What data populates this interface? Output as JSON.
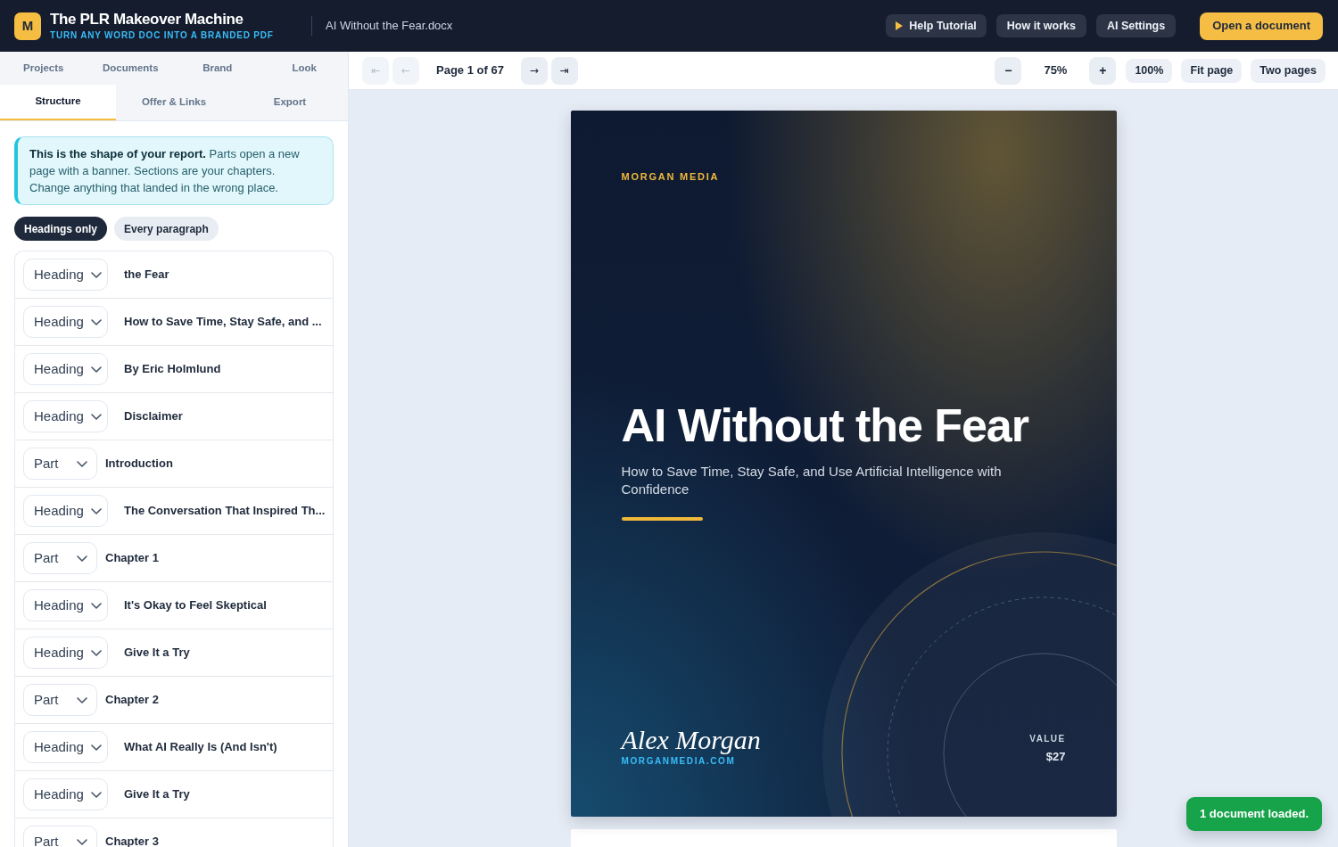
{
  "header": {
    "logo_letter": "M",
    "title": "The PLR Makeover Machine",
    "tagline": "TURN ANY WORD DOC INTO A BRANDED PDF",
    "file_name": "AI Without the Fear.docx",
    "buttons": [
      {
        "label": "Help Tutorial",
        "kind": "tutorial"
      },
      {
        "label": "How it works",
        "kind": "secondary"
      },
      {
        "label": "AI Settings",
        "kind": "secondary"
      },
      {
        "label": "Open a document",
        "kind": "primary"
      }
    ]
  },
  "sidebar": {
    "nav_tabs": [
      {
        "label": "Projects",
        "selected": false
      },
      {
        "label": "Documents",
        "selected": false
      },
      {
        "label": "Brand",
        "selected": false
      },
      {
        "label": "Look",
        "selected": false
      }
    ],
    "sub_tabs": [
      {
        "label": "Structure",
        "selected": true
      },
      {
        "label": "Offer & Links",
        "selected": false
      },
      {
        "label": "Export",
        "selected": false
      }
    ],
    "info": "**This is the shape of your report.** Parts open a new page with a banner. Sections are your chapters. Change anything that landed in the wrong place.",
    "view_modes": [
      {
        "label": "Headings only",
        "selected": true
      },
      {
        "label": "Every paragraph",
        "selected": false
      }
    ],
    "rows": [
      {
        "kind": "heading",
        "type": "Heading",
        "text": "the Fear"
      },
      {
        "kind": "heading",
        "type": "Heading",
        "text": "How to Save Time, Stay Safe, and ..."
      },
      {
        "kind": "heading",
        "type": "Heading",
        "text": "By Eric Holmlund"
      },
      {
        "kind": "heading",
        "type": "Heading",
        "text": "Disclaimer"
      },
      {
        "kind": "part",
        "type": "Part",
        "text": "Introduction"
      },
      {
        "kind": "heading",
        "type": "Heading",
        "text": "The Conversation That Inspired Th..."
      },
      {
        "kind": "part",
        "type": "Part",
        "text": "Chapter 1"
      },
      {
        "kind": "heading",
        "type": "Heading",
        "text": "It's Okay to Feel Skeptical"
      },
      {
        "kind": "heading",
        "type": "Heading",
        "text": "Give It a Try"
      },
      {
        "kind": "part",
        "type": "Part",
        "text": "Chapter 2"
      },
      {
        "kind": "heading",
        "type": "Heading",
        "text": "What AI Really Is (And Isn't)"
      },
      {
        "kind": "heading",
        "type": "Heading",
        "text": "Give It a Try"
      },
      {
        "kind": "part",
        "type": "Part",
        "text": "Chapter 3"
      }
    ]
  },
  "toolbar": {
    "page_nav": [
      {
        "label": "⇤",
        "kind": "first",
        "disabled": true
      },
      {
        "label": "←",
        "kind": "prev",
        "disabled": true
      },
      {
        "label": "→",
        "kind": "next",
        "disabled": false
      },
      {
        "label": "⇥",
        "kind": "last",
        "disabled": false
      }
    ],
    "page_label": "Page 1 of 67",
    "zoom_out": "−",
    "zoom_level": "75%",
    "zoom_in": "+",
    "view_buttons": [
      "100%",
      "Fit page",
      "Two pages"
    ]
  },
  "cover": {
    "publisher": "MORGAN MEDIA",
    "title": "AI Without the Fear",
    "subtitle": "How to Save Time, Stay Safe, and Use Artificial Intelligence with Confidence",
    "author": "Alex Morgan",
    "website": "MORGANMEDIA.COM",
    "value_label": "VALUE",
    "price": "$27"
  },
  "toast": "1 document loaded."
}
